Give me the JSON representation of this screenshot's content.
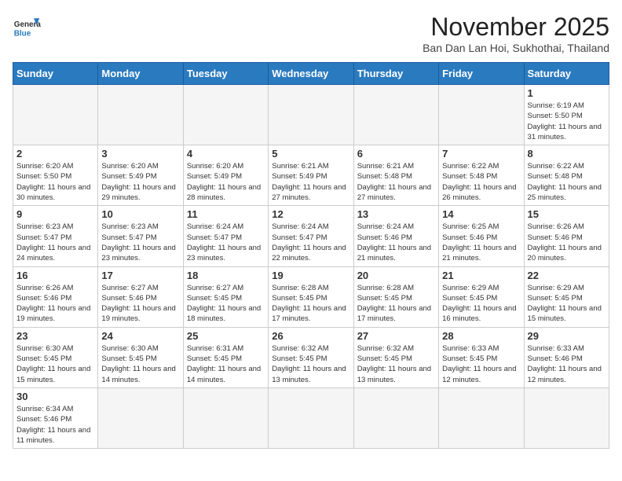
{
  "header": {
    "logo_general": "General",
    "logo_blue": "Blue",
    "month_title": "November 2025",
    "location": "Ban Dan Lan Hoi, Sukhothai, Thailand"
  },
  "weekdays": [
    "Sunday",
    "Monday",
    "Tuesday",
    "Wednesday",
    "Thursday",
    "Friday",
    "Saturday"
  ],
  "days": {
    "d1": {
      "num": "1",
      "sunrise": "6:19 AM",
      "sunset": "5:50 PM",
      "daylight": "11 hours and 31 minutes."
    },
    "d2": {
      "num": "2",
      "sunrise": "6:20 AM",
      "sunset": "5:50 PM",
      "daylight": "11 hours and 30 minutes."
    },
    "d3": {
      "num": "3",
      "sunrise": "6:20 AM",
      "sunset": "5:49 PM",
      "daylight": "11 hours and 29 minutes."
    },
    "d4": {
      "num": "4",
      "sunrise": "6:20 AM",
      "sunset": "5:49 PM",
      "daylight": "11 hours and 28 minutes."
    },
    "d5": {
      "num": "5",
      "sunrise": "6:21 AM",
      "sunset": "5:49 PM",
      "daylight": "11 hours and 27 minutes."
    },
    "d6": {
      "num": "6",
      "sunrise": "6:21 AM",
      "sunset": "5:48 PM",
      "daylight": "11 hours and 27 minutes."
    },
    "d7": {
      "num": "7",
      "sunrise": "6:22 AM",
      "sunset": "5:48 PM",
      "daylight": "11 hours and 26 minutes."
    },
    "d8": {
      "num": "8",
      "sunrise": "6:22 AM",
      "sunset": "5:48 PM",
      "daylight": "11 hours and 25 minutes."
    },
    "d9": {
      "num": "9",
      "sunrise": "6:23 AM",
      "sunset": "5:47 PM",
      "daylight": "11 hours and 24 minutes."
    },
    "d10": {
      "num": "10",
      "sunrise": "6:23 AM",
      "sunset": "5:47 PM",
      "daylight": "11 hours and 23 minutes."
    },
    "d11": {
      "num": "11",
      "sunrise": "6:24 AM",
      "sunset": "5:47 PM",
      "daylight": "11 hours and 23 minutes."
    },
    "d12": {
      "num": "12",
      "sunrise": "6:24 AM",
      "sunset": "5:47 PM",
      "daylight": "11 hours and 22 minutes."
    },
    "d13": {
      "num": "13",
      "sunrise": "6:24 AM",
      "sunset": "5:46 PM",
      "daylight": "11 hours and 21 minutes."
    },
    "d14": {
      "num": "14",
      "sunrise": "6:25 AM",
      "sunset": "5:46 PM",
      "daylight": "11 hours and 21 minutes."
    },
    "d15": {
      "num": "15",
      "sunrise": "6:26 AM",
      "sunset": "5:46 PM",
      "daylight": "11 hours and 20 minutes."
    },
    "d16": {
      "num": "16",
      "sunrise": "6:26 AM",
      "sunset": "5:46 PM",
      "daylight": "11 hours and 19 minutes."
    },
    "d17": {
      "num": "17",
      "sunrise": "6:27 AM",
      "sunset": "5:46 PM",
      "daylight": "11 hours and 19 minutes."
    },
    "d18": {
      "num": "18",
      "sunrise": "6:27 AM",
      "sunset": "5:45 PM",
      "daylight": "11 hours and 18 minutes."
    },
    "d19": {
      "num": "19",
      "sunrise": "6:28 AM",
      "sunset": "5:45 PM",
      "daylight": "11 hours and 17 minutes."
    },
    "d20": {
      "num": "20",
      "sunrise": "6:28 AM",
      "sunset": "5:45 PM",
      "daylight": "11 hours and 17 minutes."
    },
    "d21": {
      "num": "21",
      "sunrise": "6:29 AM",
      "sunset": "5:45 PM",
      "daylight": "11 hours and 16 minutes."
    },
    "d22": {
      "num": "22",
      "sunrise": "6:29 AM",
      "sunset": "5:45 PM",
      "daylight": "11 hours and 15 minutes."
    },
    "d23": {
      "num": "23",
      "sunrise": "6:30 AM",
      "sunset": "5:45 PM",
      "daylight": "11 hours and 15 minutes."
    },
    "d24": {
      "num": "24",
      "sunrise": "6:30 AM",
      "sunset": "5:45 PM",
      "daylight": "11 hours and 14 minutes."
    },
    "d25": {
      "num": "25",
      "sunrise": "6:31 AM",
      "sunset": "5:45 PM",
      "daylight": "11 hours and 14 minutes."
    },
    "d26": {
      "num": "26",
      "sunrise": "6:32 AM",
      "sunset": "5:45 PM",
      "daylight": "11 hours and 13 minutes."
    },
    "d27": {
      "num": "27",
      "sunrise": "6:32 AM",
      "sunset": "5:45 PM",
      "daylight": "11 hours and 13 minutes."
    },
    "d28": {
      "num": "28",
      "sunrise": "6:33 AM",
      "sunset": "5:45 PM",
      "daylight": "11 hours and 12 minutes."
    },
    "d29": {
      "num": "29",
      "sunrise": "6:33 AM",
      "sunset": "5:46 PM",
      "daylight": "11 hours and 12 minutes."
    },
    "d30": {
      "num": "30",
      "sunrise": "6:34 AM",
      "sunset": "5:46 PM",
      "daylight": "11 hours and 11 minutes."
    }
  },
  "labels": {
    "sunrise": "Sunrise:",
    "sunset": "Sunset:",
    "daylight": "Daylight:"
  }
}
